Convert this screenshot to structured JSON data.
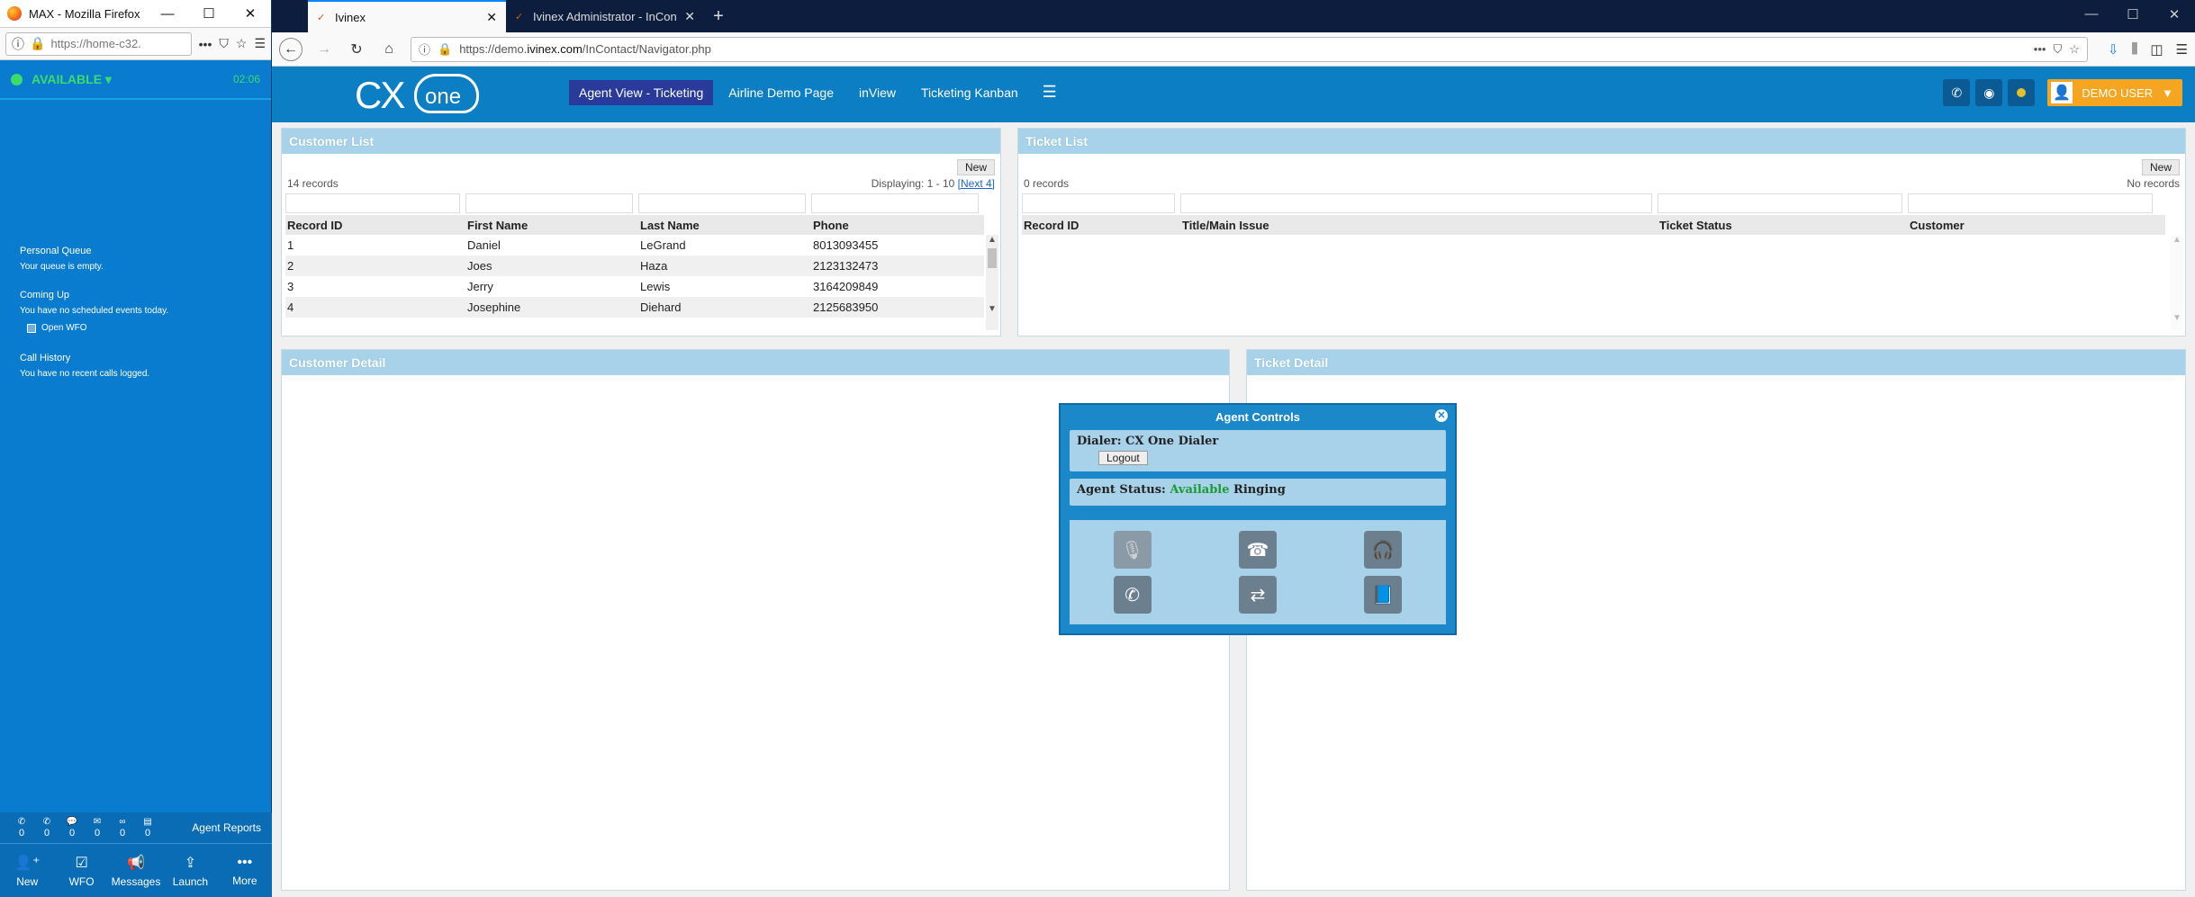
{
  "max": {
    "window_title": "MAX - Mozilla Firefox",
    "url": "https://home-c32.",
    "status": "AVAILABLE",
    "timer": "02:06",
    "personal_queue": "Personal Queue",
    "queue_empty": "Your queue is empty.",
    "coming_up": "Coming Up",
    "no_events": "You have no scheduled events today.",
    "open_wfo": "Open WFO",
    "call_history": "Call History",
    "no_calls": "You have no recent calls logged.",
    "counters": [
      "0",
      "0",
      "0",
      "0",
      "0",
      "0"
    ],
    "agent_reports": "Agent Reports",
    "nav": [
      "New",
      "WFO",
      "Messages",
      "Launch",
      "More"
    ]
  },
  "browser": {
    "tabs": [
      "Ivinex",
      "Ivinex Administrator - InContact"
    ],
    "url_prefix": "https://demo.",
    "url_domain": "ivinex.com",
    "url_path": "/InContact/Navigator.php"
  },
  "app": {
    "nav": [
      "Agent View - Ticketing",
      "Airline Demo Page",
      "inView",
      "Ticketing Kanban"
    ],
    "user": "DEMO USER",
    "user_caret": "▼"
  },
  "customer_list": {
    "title": "Customer List",
    "new_label": "New",
    "records": "14 records",
    "displaying": "Displaying: 1 - 10",
    "next": "[Next 4]",
    "columns": [
      "Record ID",
      "First Name",
      "Last Name",
      "Phone"
    ],
    "rows": [
      [
        "1",
        "Daniel",
        "LeGrand",
        "8013093455"
      ],
      [
        "2",
        "Joes",
        "Haza",
        "2123132473"
      ],
      [
        "3",
        "Jerry",
        "Lewis",
        "3164209849"
      ],
      [
        "4",
        "Josephine",
        "Diehard",
        "2125683950"
      ]
    ]
  },
  "ticket_list": {
    "title": "Ticket List",
    "new_label": "New",
    "records": "0 records",
    "no_records": "No records",
    "columns": [
      "Record ID",
      "Title/Main Issue",
      "Ticket Status",
      "Customer"
    ]
  },
  "customer_detail": {
    "title": "Customer Detail"
  },
  "ticket_detail": {
    "title": "Ticket Detail"
  },
  "agent_controls": {
    "title": "Agent Controls",
    "dialer_label": "Dialer:",
    "dialer_value": "CX One Dialer",
    "logout": "Logout",
    "status_label": "Agent Status:",
    "status_value": "Available",
    "status_extra": "Ringing"
  }
}
